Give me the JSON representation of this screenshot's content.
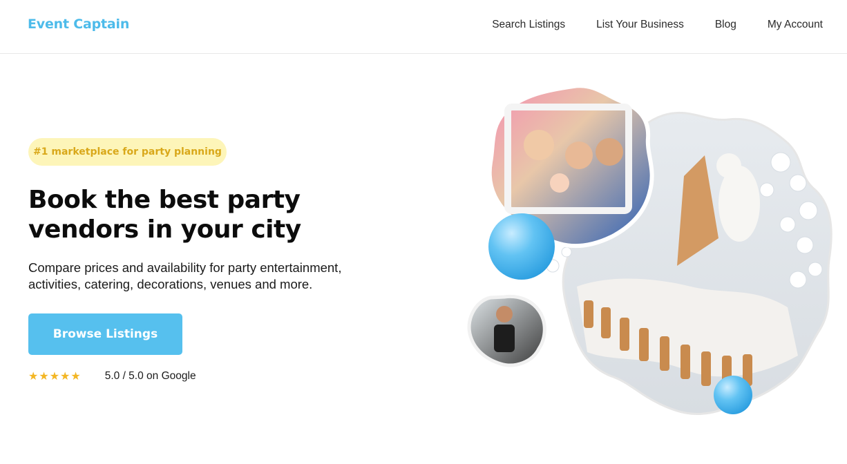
{
  "header": {
    "logo": "Event Captain",
    "nav": [
      {
        "label": "Search Listings"
      },
      {
        "label": "List Your Business"
      },
      {
        "label": "Blog"
      },
      {
        "label": "My Account"
      }
    ]
  },
  "hero": {
    "badge": "#1 marketplace for party planning",
    "headline": "Book the best party vendors in your city",
    "subtext": "Compare prices and availability for party entertainment, activities, catering, decorations, venues and more.",
    "cta_label": "Browse Listings",
    "stars": "★★★★★",
    "rating_text": "5.0 / 5.0 on Google"
  },
  "colors": {
    "brand": "#4dbbea",
    "cta": "#56c0ee",
    "badge_bg": "#fdf5b9",
    "badge_text": "#d9a81a",
    "stars": "#f3b624"
  },
  "images": [
    {
      "name": "photo-booth-family-photo"
    },
    {
      "name": "winter-wonderland-banquet-photo"
    },
    {
      "name": "chef-catering-photo"
    }
  ]
}
